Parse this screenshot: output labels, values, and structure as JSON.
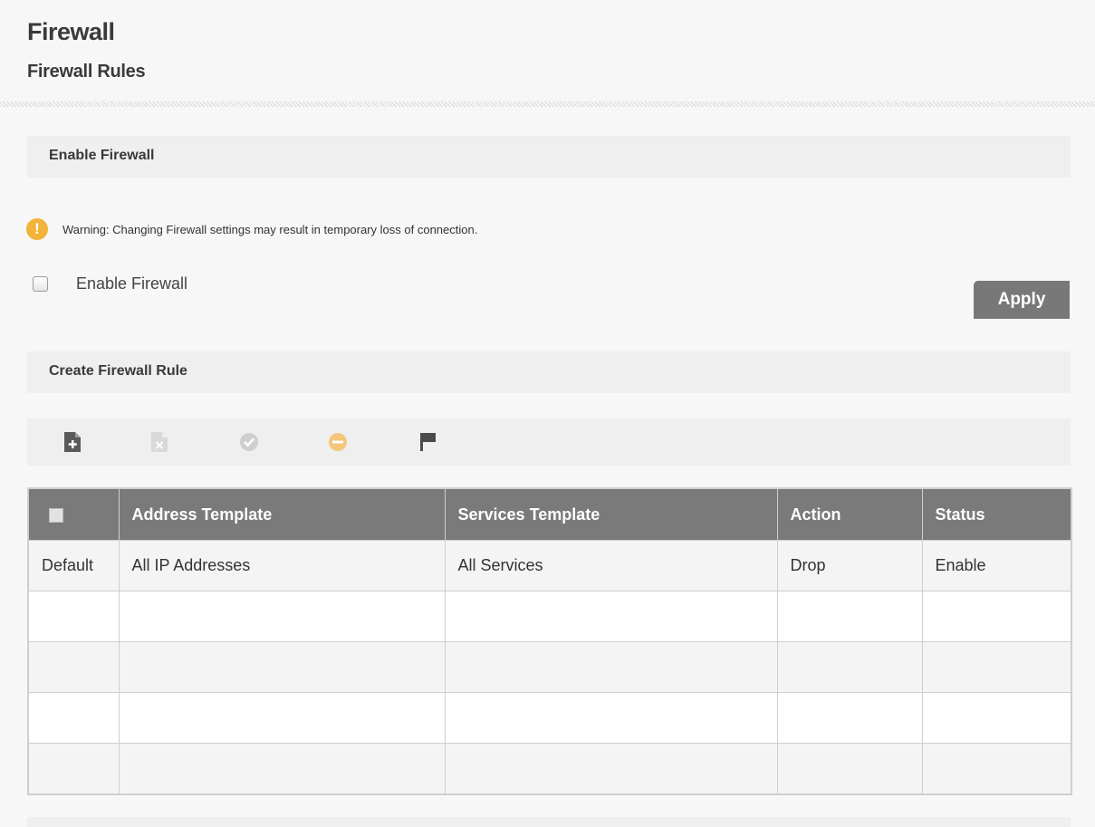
{
  "page": {
    "title": "Firewall",
    "subtitle": "Firewall Rules"
  },
  "enable_section": {
    "header": "Enable Firewall",
    "warning_icon": "exclamation-circle-icon",
    "warning_text": "Warning: Changing Firewall settings may result in temporary loss of connection.",
    "checkbox_label": "Enable Firewall",
    "checkbox_checked": false,
    "apply_label": "Apply"
  },
  "rule_section": {
    "header": "Create Firewall Rule",
    "toolbar": [
      {
        "icon": "add-document-icon",
        "enabled": true
      },
      {
        "icon": "delete-document-icon",
        "enabled": false
      },
      {
        "icon": "check-circle-icon",
        "enabled": false
      },
      {
        "icon": "minus-circle-icon",
        "enabled": true
      },
      {
        "icon": "flag-icon",
        "enabled": true
      }
    ]
  },
  "table": {
    "columns": [
      "",
      "Address Template",
      "Services Template",
      "Action",
      "Status"
    ],
    "rows": [
      [
        "Default",
        "All IP Addresses",
        "All Services",
        "Drop",
        "Enable"
      ],
      [
        "",
        "",
        "",
        "",
        ""
      ],
      [
        "",
        "",
        "",
        "",
        ""
      ],
      [
        "",
        "",
        "",
        "",
        ""
      ],
      [
        "",
        "",
        "",
        "",
        ""
      ]
    ]
  },
  "colors": {
    "header_bg": "#7a7a7a",
    "warning": "#f2b33a",
    "button": "#787878",
    "section_bg": "#efefef"
  }
}
